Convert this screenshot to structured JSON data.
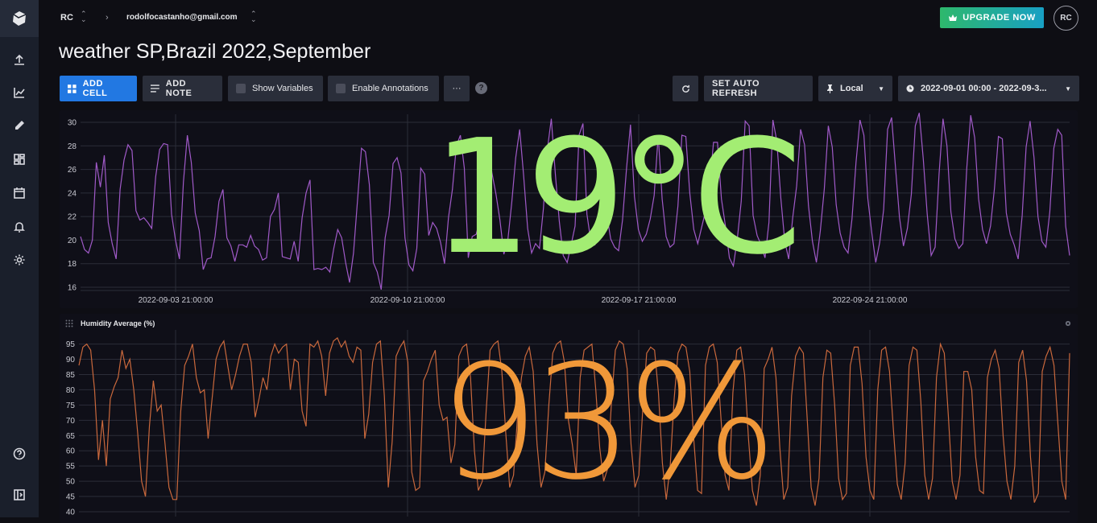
{
  "sidebar": {
    "items": [
      {
        "icon": "upload-icon"
      },
      {
        "icon": "chart-line-icon"
      },
      {
        "icon": "pencil-icon"
      },
      {
        "icon": "dashboards-icon"
      },
      {
        "icon": "calendar-icon"
      },
      {
        "icon": "bell-icon"
      },
      {
        "icon": "gear-icon"
      }
    ],
    "bottom": [
      {
        "icon": "help-icon"
      },
      {
        "icon": "expand-sidebar-icon"
      }
    ]
  },
  "header": {
    "org": "RC",
    "account": "rodolfocastanho@gmail.com",
    "upgrade_label": "UPGRADE NOW",
    "avatar": "RC"
  },
  "page_title": "weather SP,Brazil 2022,September",
  "toolbar": {
    "add_cell": "ADD CELL",
    "add_note": "ADD NOTE",
    "show_variables": "Show Variables",
    "enable_annotations": "Enable Annotations",
    "more": "···",
    "help": "?",
    "auto_refresh": "SET AUTO REFRESH",
    "timezone": "Local",
    "time_range": "2022-09-01 00:00 - 2022-09-3..."
  },
  "colors": {
    "temp": "#a3ed73",
    "temp_line": "#a05ac8",
    "hum": "#f09839",
    "hum_line": "#c9683c",
    "accent": "#2278e2"
  },
  "cells": {
    "temperature": {
      "big_value": "19°C",
      "y_ticks": [
        "30",
        "28",
        "26",
        "24",
        "22",
        "20",
        "18",
        "16"
      ],
      "x_ticks": [
        "2022-09-03 21:00:00",
        "2022-09-10 21:00:00",
        "2022-09-17 21:00:00",
        "2022-09-24 21:00:00"
      ]
    },
    "humidity": {
      "title": "Humidity Average (%)",
      "big_value": "93%",
      "y_ticks": [
        "95",
        "90",
        "85",
        "80",
        "75",
        "70",
        "65",
        "60",
        "55",
        "50",
        "45",
        "40"
      ]
    }
  },
  "chart_data": [
    {
      "type": "line",
      "title": "",
      "ylim": [
        16,
        30
      ],
      "y_ticks": [
        30,
        28,
        26,
        24,
        22,
        20,
        18,
        16
      ],
      "x_ticks": [
        "2022-09-03 21:00:00",
        "2022-09-10 21:00:00",
        "2022-09-17 21:00:00",
        "2022-09-24 21:00:00"
      ],
      "x_range": [
        "2022-09-01 00:00",
        "2022-09-30 23:00"
      ],
      "series": [
        {
          "values": [
            20.3,
            19.2,
            18.9,
            20,
            26.6,
            24.5,
            27.2,
            21.5,
            19.7,
            18.4,
            24.3,
            26.8,
            28.1,
            27.6,
            22.5,
            21.7,
            21.9,
            21.5,
            21,
            25.4,
            27.7,
            28.2,
            28.1,
            22.2,
            20,
            18.4,
            24.9,
            28.9,
            26.6,
            22.3,
            20.8,
            17.5,
            18.4,
            18.5,
            20.3,
            23.3,
            24.3,
            20.2,
            19.5,
            18.2,
            19.6,
            19.6,
            19.4,
            20.4,
            19.5,
            19.2,
            18.3,
            18.5,
            22,
            22.6,
            24,
            18.6,
            18.5,
            18.4,
            19.9,
            18.2,
            21.9,
            24,
            25.1,
            17.5,
            17.6,
            17.5,
            17.7,
            17.3,
            19.3,
            20.9,
            20.2,
            18.1,
            16.4,
            18.9,
            23.3,
            27.8,
            27.5,
            24.7,
            18.1,
            17.3,
            15.8,
            20.2,
            22.1,
            26.5,
            27,
            25.7,
            20.2,
            17.9,
            17.4,
            19.3,
            26.1,
            25.6,
            20.4,
            21.5,
            21,
            19.8,
            18,
            21.9,
            24.3,
            28,
            28.9,
            26.1,
            18.5,
            20.3,
            20.5,
            21.8,
            26.3,
            28,
            25.7,
            23.9,
            21.7,
            18.8,
            20,
            23.2,
            27,
            29.4,
            25.5,
            21,
            18.9,
            19.7,
            19.3,
            22.7,
            27.7,
            30.3,
            25.7,
            21.6,
            18.7,
            18.1,
            19.6,
            21.2,
            28.9,
            29.9,
            22.2,
            19.9,
            19.6,
            20.5,
            23.3,
            22.2,
            20.1,
            19.4,
            19.1,
            21.7,
            26.1,
            29.8,
            23.7,
            20.9,
            19.9,
            20.5,
            21.8,
            23.8,
            28.9,
            23.5,
            20.3,
            19.4,
            19.7,
            22.9,
            28.9,
            28.8,
            24,
            20.9,
            19.7,
            21.1,
            22.5,
            24.7,
            28.3,
            28.3,
            23.5,
            21.2,
            18.5,
            17.8,
            20.1,
            23.3,
            30.1,
            29.7,
            22.1,
            20.4,
            19.6,
            18.5,
            21.5,
            30.2,
            28.4,
            23.6,
            19.9,
            18.4,
            21.9,
            24.6,
            29.4,
            28.1,
            22.9,
            19.9,
            18.1,
            20.8,
            24.4,
            29.7,
            27.9,
            23,
            20.6,
            19.4,
            18.9,
            21.8,
            26.6,
            30.2,
            28.9,
            23.5,
            20.6,
            18.1,
            19.8,
            22.6,
            29.4,
            30.4,
            26.1,
            21.9,
            19.5,
            21,
            23.9,
            29.7,
            30.8,
            26.9,
            22.2,
            18.7,
            19.4,
            25.6,
            30.3,
            28,
            22.4,
            20.1,
            19.3,
            19.7,
            26.1,
            30.6,
            28.7,
            23.5,
            20.9,
            19.7,
            21.2,
            24.4,
            28.8,
            28.6,
            22.3,
            20.5,
            19.6,
            18.4,
            22.1,
            27.9,
            30.1,
            27,
            22,
            19.9,
            19.4,
            22.4,
            27.8,
            29.4,
            28.9,
            21.2,
            18.7
          ]
        }
      ]
    },
    {
      "type": "line",
      "title": "Humidity Average (%)",
      "ylim": [
        40,
        97
      ],
      "y_ticks": [
        95,
        90,
        85,
        80,
        75,
        70,
        65,
        60,
        55,
        50,
        45,
        40
      ],
      "series": [
        {
          "values": [
            88,
            94,
            95,
            93,
            80,
            57,
            70,
            55,
            77,
            81,
            84,
            93,
            87,
            90,
            80,
            66,
            50,
            45,
            68,
            83,
            73,
            75,
            62,
            48,
            44,
            44,
            73,
            88,
            91,
            95,
            84,
            79,
            80,
            64,
            77,
            90,
            94,
            96,
            88,
            80,
            85,
            91,
            95,
            95,
            89,
            71,
            77,
            84,
            80,
            91,
            95,
            92,
            94,
            95,
            80,
            90,
            89,
            73,
            68,
            95,
            94,
            96,
            91,
            78,
            92,
            96,
            97,
            94,
            96,
            91,
            89,
            94,
            93,
            64,
            72,
            89,
            95,
            96,
            78,
            48,
            63,
            91,
            94,
            96,
            89,
            53,
            47,
            48,
            83,
            86,
            90,
            93,
            75,
            70,
            71,
            56,
            62,
            91,
            94,
            95,
            84,
            60,
            47,
            50,
            73,
            93,
            95,
            96,
            86,
            66,
            48,
            52,
            71,
            84,
            91,
            94,
            86,
            62,
            48,
            53,
            75,
            92,
            95,
            96,
            89,
            70,
            62,
            52,
            84,
            93,
            94,
            95,
            80,
            61,
            50,
            54,
            76,
            93,
            96,
            95,
            87,
            62,
            48,
            52,
            74,
            92,
            94,
            93,
            79,
            56,
            44,
            55,
            77,
            92,
            95,
            94,
            86,
            64,
            47,
            46,
            88,
            94,
            95,
            89,
            70,
            52,
            47,
            79,
            93,
            94,
            85,
            64,
            47,
            42,
            52,
            87,
            90,
            94,
            84,
            61,
            44,
            48,
            78,
            91,
            94,
            92,
            70,
            48,
            42,
            51,
            84,
            93,
            92,
            75,
            51,
            44,
            46,
            88,
            94,
            94,
            82,
            58,
            47,
            44,
            80,
            93,
            94,
            86,
            67,
            49,
            44,
            56,
            88,
            94,
            93,
            76,
            52,
            44,
            51,
            84,
            95,
            92,
            72,
            50,
            44,
            52,
            86,
            86,
            80,
            58,
            47,
            46,
            84,
            90,
            93,
            87,
            65,
            50,
            44,
            55,
            89,
            93,
            83,
            58,
            43,
            46,
            86,
            91,
            94,
            88,
            69,
            50,
            44,
            92
          ]
        }
      ]
    }
  ]
}
